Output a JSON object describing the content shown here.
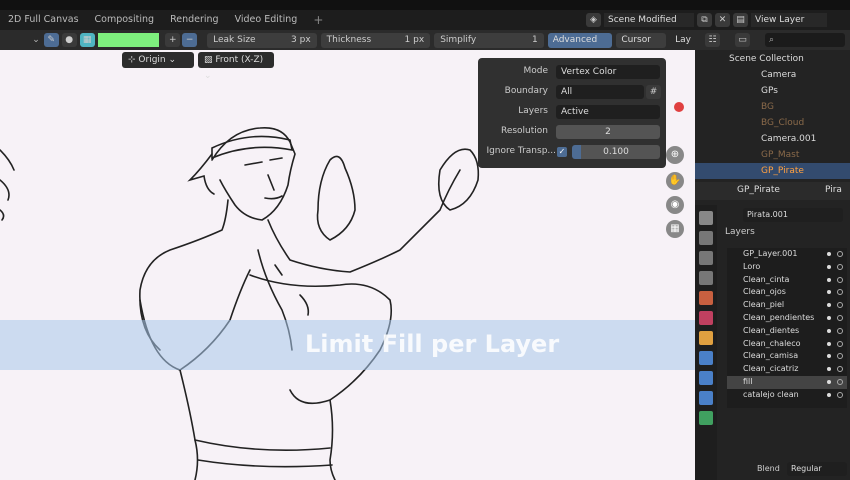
{
  "workspace_tabs": [
    "2D Full Canvas",
    "Compositing",
    "Rendering",
    "Video Editing",
    "+"
  ],
  "scene": {
    "name": "Scene Modified",
    "view_layer": "View Layer"
  },
  "toolbar": {
    "leak_size_label": "Leak Size",
    "leak_size_value": "3 px",
    "thickness_label": "Thickness",
    "thickness_value": "1 px",
    "simplify_label": "Simplify",
    "simplify_value": "1",
    "advanced_label": "Advanced",
    "cursor_label": "Cursor",
    "layer_label": "Lay",
    "color": "#7ef07e"
  },
  "viewport": {
    "origin_label": "Origin",
    "view_label": "Front (X-Z)"
  },
  "advanced_popup": {
    "mode_label": "Mode",
    "mode_value": "Vertex Color",
    "boundary_label": "Boundary",
    "boundary_value": "All",
    "layers_label": "Layers",
    "layers_value": "Active",
    "resolution_label": "Resolution",
    "resolution_value": "2",
    "ignore_label": "Ignore Transp...",
    "ignore_value": "0.100"
  },
  "overlay_caption": "Limit Fill per Layer",
  "outliner": {
    "root": "Scene Collection",
    "items": [
      {
        "label": "Camera",
        "dim": false
      },
      {
        "label": "GPs",
        "dim": false
      },
      {
        "label": "BG",
        "dim": true
      },
      {
        "label": "BG_Cloud",
        "dim": true
      },
      {
        "label": "Camera.001",
        "dim": false
      },
      {
        "label": "GP_Mast",
        "dim": true
      },
      {
        "label": "GP_Pirate",
        "dim": false
      }
    ]
  },
  "properties": {
    "object_name": "GP_Pirate",
    "object_name_2": "Pira",
    "data_name": "Pirata.001",
    "layers_header": "Layers",
    "layers": [
      "GP_Layer.001",
      "Loro",
      "Clean_cinta",
      "Clean_ojos",
      "Clean_piel",
      "Clean_pendientes",
      "Clean_dientes",
      "Clean_chaleco",
      "Clean_camisa",
      "Clean_cicatriz",
      "fill",
      "catalejo clean"
    ],
    "blend_label": "Blend",
    "blend_value": "Regular"
  }
}
